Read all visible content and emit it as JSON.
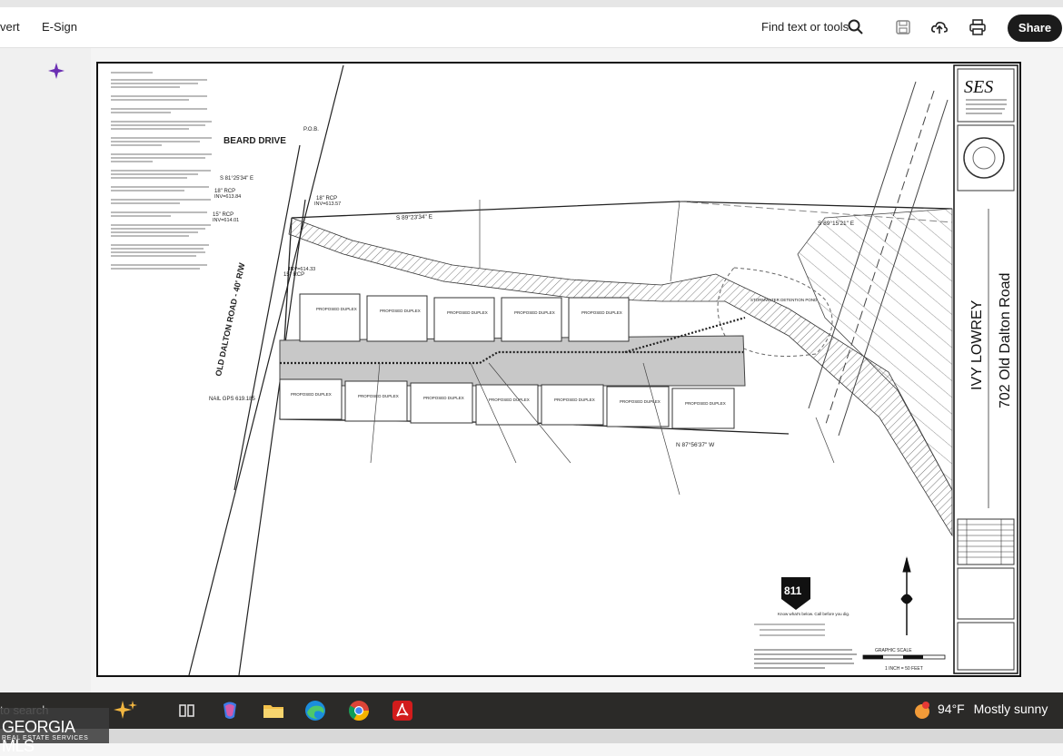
{
  "toolbar": {
    "convert_label": "vert",
    "esign_label": "E-Sign",
    "find_label": "Find text or tools",
    "share_label": "Share"
  },
  "drawing": {
    "firm_logo": "SES",
    "project_title": "IVY LOWREY",
    "project_address": "702 Old Dalton Road",
    "road_left": "OLD DALTON ROAD - 40' R/W",
    "road_top": "BEARD DRIVE",
    "pob": "P.O.B.",
    "bearing_1": "S 89°23'34\" E",
    "bearing_2": "S 89°15'21\" E",
    "bearing_3": "N 87°56'37\" W",
    "bearing_4": "S 81°25'34\" E",
    "pipe_1": "18\" RCP",
    "pipe_2": "15\" RCP",
    "pipe_3": "18\" RCP",
    "pipe_4": "15\" RCP",
    "inv_1": "INV=613.57",
    "inv_2": "INV=614.01",
    "inv_3": "INV=613.84",
    "inv_4": "INV=614.33",
    "nail": "NAIL GPS 619.185",
    "duplex": "PROPOSED DUPLEX",
    "detention": "STORMWATER DETENTION POND",
    "call_text": "Know what's below. Call before you dig.",
    "call_811": "811",
    "graphic_scale": "GRAPHIC SCALE",
    "scale_text": "1 INCH = 50 FEET"
  },
  "taskbar": {
    "search_text": "to search",
    "temperature": "94°F",
    "weather": "Mostly sunny"
  },
  "watermark": {
    "brand": "GEORGIA MLS",
    "tagline": "REAL ESTATE SERVICES"
  }
}
